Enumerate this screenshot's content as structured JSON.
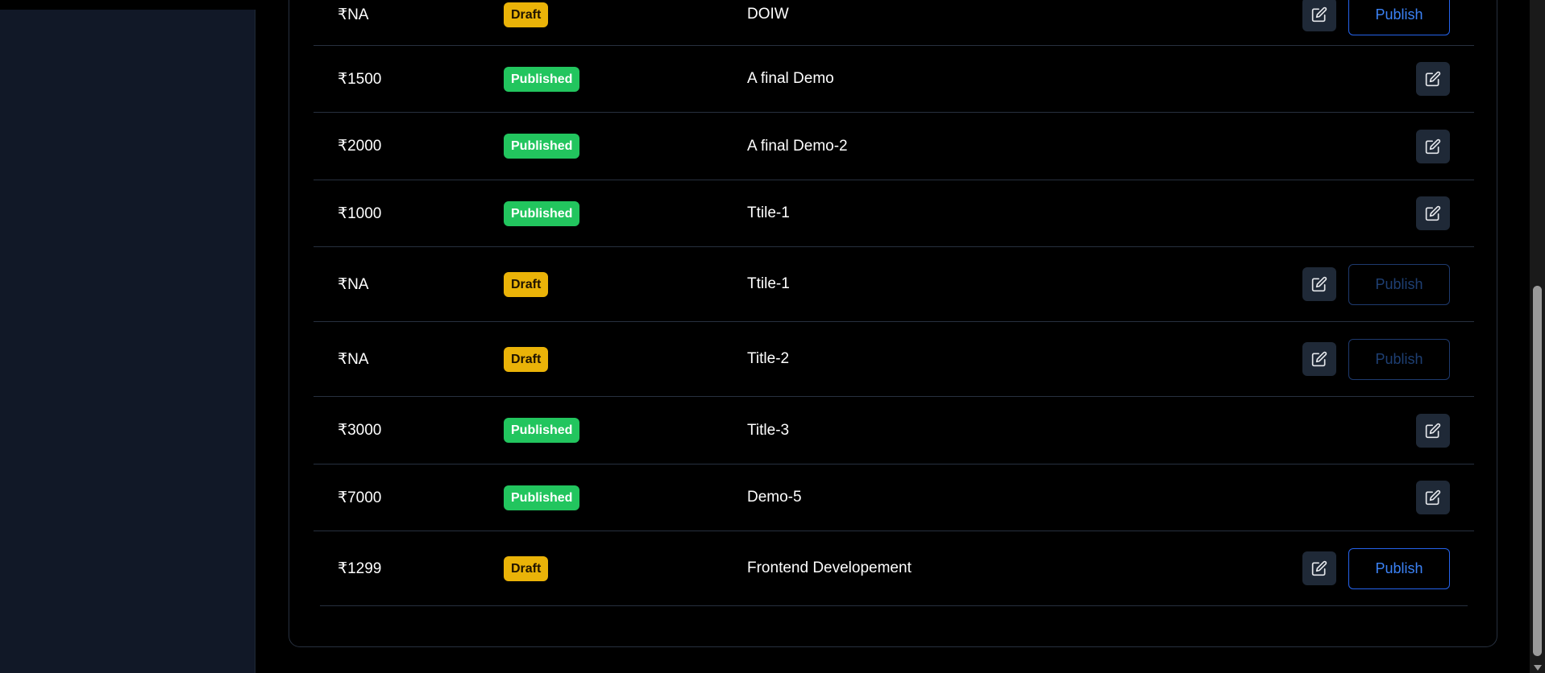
{
  "colors": {
    "background": "#000000",
    "sidebar": "#111827",
    "border": "#27303f",
    "draft_badge": "#eab308",
    "published_badge": "#22c55e",
    "publish_button": "#3b82f6",
    "edit_button": "#1f2937"
  },
  "courses": [
    {
      "price": "₹NA",
      "status": "Draft",
      "title": "DOIW",
      "publish_label": "Publish",
      "publish_enabled": true
    },
    {
      "price": "₹1500",
      "status": "Published",
      "title": "A final Demo"
    },
    {
      "price": "₹2000",
      "status": "Published",
      "title": "A final Demo-2"
    },
    {
      "price": "₹1000",
      "status": "Published",
      "title": "Ttile-1"
    },
    {
      "price": "₹NA",
      "status": "Draft",
      "title": "Ttile-1",
      "publish_label": "Publish",
      "publish_enabled": false
    },
    {
      "price": "₹NA",
      "status": "Draft",
      "title": "Title-2",
      "publish_label": "Publish",
      "publish_enabled": false
    },
    {
      "price": "₹3000",
      "status": "Published",
      "title": "Title-3"
    },
    {
      "price": "₹7000",
      "status": "Published",
      "title": "Demo-5"
    },
    {
      "price": "₹1299",
      "status": "Draft",
      "title": "Frontend Developement",
      "publish_label": "Publish",
      "publish_enabled": true
    }
  ],
  "icons": {
    "edit": "edit-icon"
  }
}
